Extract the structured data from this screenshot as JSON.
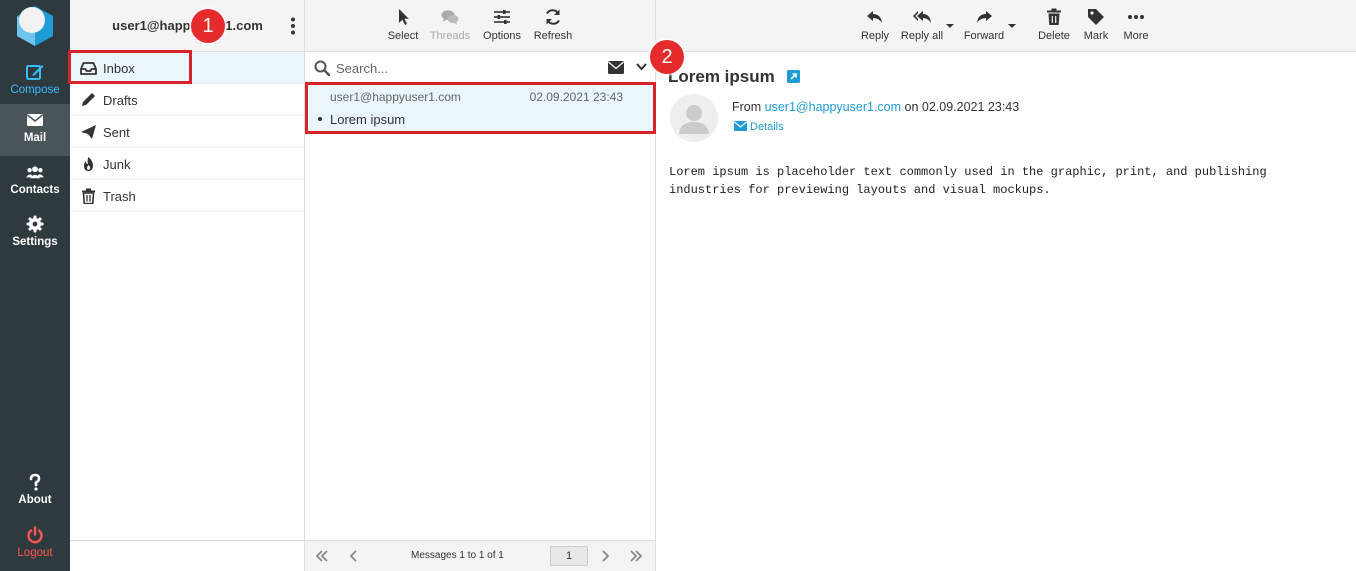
{
  "nav": {
    "compose": "Compose",
    "mail": "Mail",
    "contacts": "Contacts",
    "settings": "Settings",
    "about": "About",
    "logout": "Logout"
  },
  "account": {
    "email": "user1@happyuser1.com"
  },
  "folders": [
    {
      "label": "Inbox",
      "icon": "inbox-icon"
    },
    {
      "label": "Drafts",
      "icon": "pencil-icon"
    },
    {
      "label": "Sent",
      "icon": "paper-plane-icon"
    },
    {
      "label": "Junk",
      "icon": "fire-icon"
    },
    {
      "label": "Trash",
      "icon": "trash-icon"
    }
  ],
  "list_toolbar": {
    "select": "Select",
    "threads": "Threads",
    "options": "Options",
    "refresh": "Refresh"
  },
  "search": {
    "placeholder": "Search..."
  },
  "messages": [
    {
      "from": "user1@happyuser1.com",
      "date": "02.09.2021 23:43",
      "subject": "Lorem ipsum"
    }
  ],
  "list_footer": {
    "count": "Messages 1 to 1 of 1",
    "page": "1"
  },
  "pane_toolbar": {
    "reply": "Reply",
    "reply_all": "Reply all",
    "forward": "Forward",
    "delete": "Delete",
    "mark": "Mark",
    "more": "More"
  },
  "message": {
    "subject": "Lorem ipsum",
    "from_prefix": "From",
    "from_email": "user1@happyuser1.com",
    "on_text": "on 02.09.2021 23:43",
    "details": "Details",
    "body": "Lorem ipsum is placeholder text commonly used in the graphic, print, and publishing industries for previewing layouts and visual mockups."
  },
  "callouts": {
    "one": "1",
    "two": "2"
  },
  "colors": {
    "accent": "#37beff",
    "link": "#1e9cd6",
    "highlight": "#d8232a",
    "nav_bg": "#2f3a3f"
  }
}
